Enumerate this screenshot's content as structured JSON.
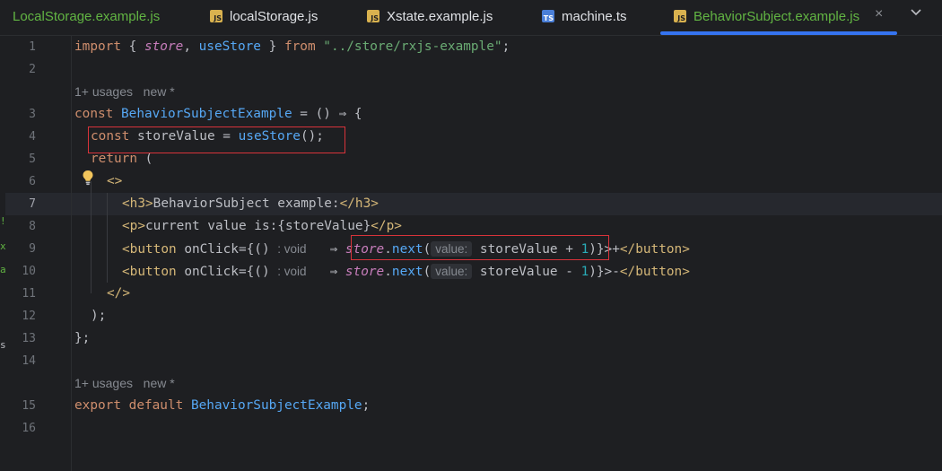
{
  "tabs": [
    {
      "label": "LocalStorage.example.js",
      "icon": "none"
    },
    {
      "label": "localStorage.js",
      "icon": "js-file-icon",
      "badge": "JS"
    },
    {
      "label": "Xstate.example.js",
      "icon": "js-file-icon",
      "badge": "JS"
    },
    {
      "label": "machine.ts",
      "icon": "ts-file-icon",
      "badge": "TS"
    },
    {
      "label": "BehaviorSubject.example.js",
      "icon": "js-file-icon",
      "badge": "JS",
      "active": true
    }
  ],
  "tab_close_glyph": "×",
  "tab_more_glyph": "⌵",
  "left_strip_chars": [
    "!",
    "x",
    "a",
    "s"
  ],
  "hints": {
    "usages_1": "1+ usages   new *",
    "usages_2": "1+ usages   new *",
    "void_1": ": void",
    "void_2": ": void",
    "param_1": "value:",
    "param_2": "value:"
  },
  "line_numbers": [
    "1",
    "2",
    "3",
    "4",
    "5",
    "6",
    "7",
    "8",
    "9",
    "10",
    "11",
    "12",
    "13",
    "14",
    "15",
    "16"
  ],
  "code": {
    "l1_import": "import",
    "l1_open": " { ",
    "l1_store": "store",
    "l1_comma": ", ",
    "l1_usestore": "useStore",
    "l1_close": " } ",
    "l1_from": "from",
    "l1_sp": " ",
    "l1_path": "\"../store/rxjs-example\"",
    "l1_semi": ";",
    "l3_const": "const",
    "l3_sp": " ",
    "l3_name": "BehaviorSubjectExample",
    "l3_rest": " = () ⇒ {",
    "l4_const": "const",
    "l4_mid": " storeValue = ",
    "l4_fn": "useStore",
    "l4_end": "();",
    "l5_return": "return",
    "l5_end": " (",
    "l6_frag": "<>",
    "l7_open": "<h3>",
    "l7_text": "BehaviorSubject example:",
    "l7_close": "</h3>",
    "l8_open": "<p>",
    "l8_text": "current value is:{storeValue}",
    "l8_close": "</p>",
    "l9_open": "<button",
    "l9_attr": " onClick={()",
    "l9_arrow": "  ⇒ ",
    "l9_store": "store",
    "l9_dot": ".",
    "l9_next": "next",
    "l9_paren": "(",
    "l9_arg": " storeValue + ",
    "l9_num": "1",
    "l9_end": ")}>+",
    "l9_close": "</button>",
    "l10_open": "<button",
    "l10_attr": " onClick={()",
    "l10_arrow": "  ⇒ ",
    "l10_store": "store",
    "l10_dot": ".",
    "l10_next": "next",
    "l10_paren": "(",
    "l10_arg": " storeValue - ",
    "l10_num": "1",
    "l10_end": ")}>-",
    "l10_close": "</button>",
    "l11_frag": "</>",
    "l12": ");",
    "l13": "};",
    "l15_export": "export",
    "l15_sp1": " ",
    "l15_default": "default",
    "l15_sp2": " ",
    "l15_name": "BehaviorSubjectExample",
    "l15_semi": ";"
  },
  "colors": {
    "keyword": "#cf8e6d",
    "string": "#6aab73",
    "function": "#56a8f5",
    "tag": "#d5b778",
    "number": "#2aacb8",
    "highlight_box": "#d8333a",
    "active_tab_underline": "#3574f0"
  }
}
